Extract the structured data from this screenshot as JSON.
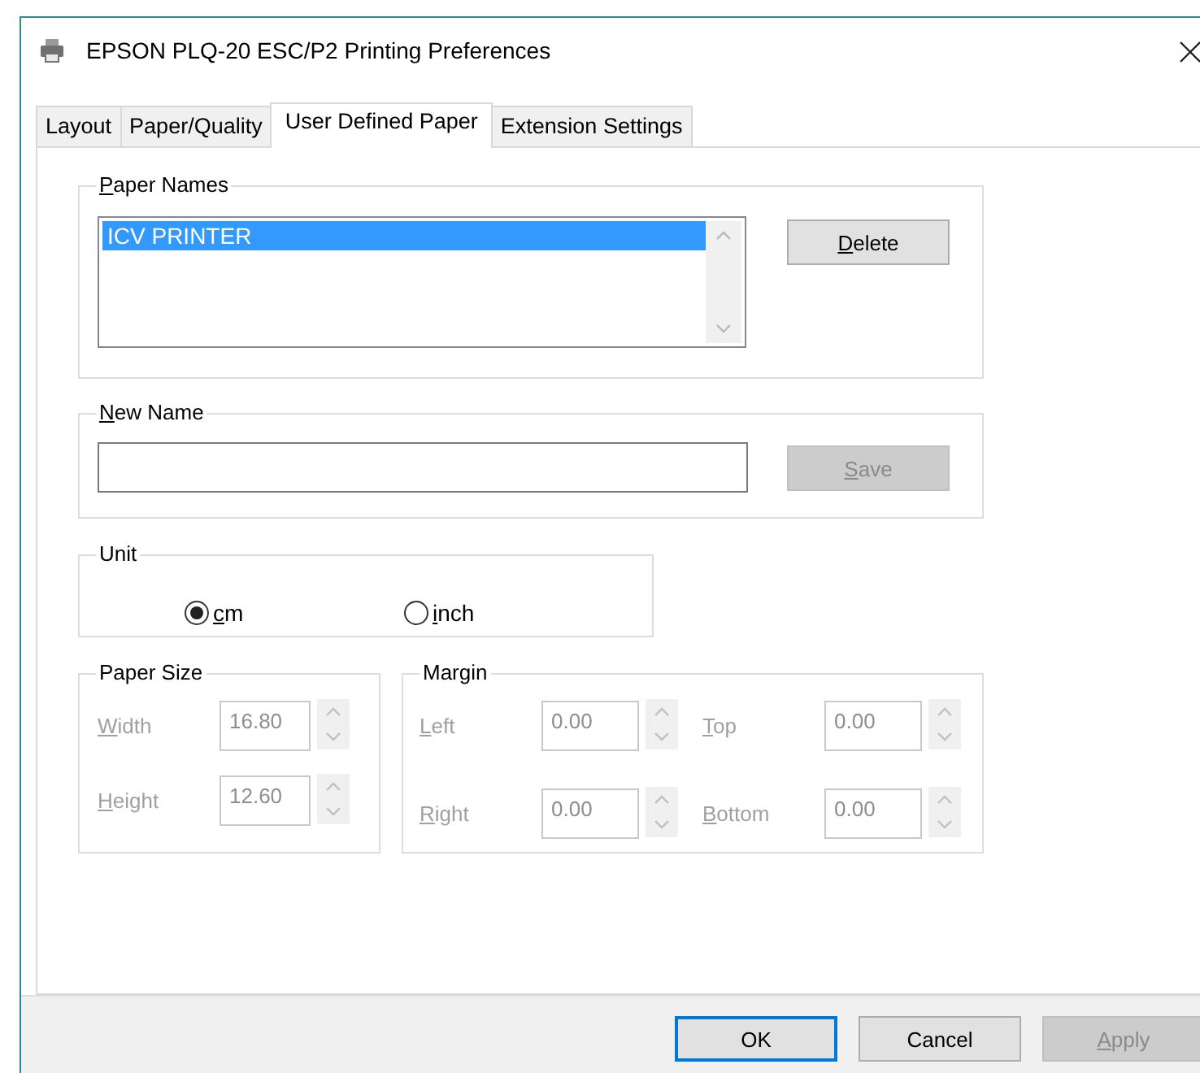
{
  "window": {
    "title": "EPSON PLQ-20 ESC/P2 Printing Preferences"
  },
  "tabs": [
    {
      "label": "Layout",
      "selected": false
    },
    {
      "label": "Paper/Quality",
      "selected": false
    },
    {
      "label": "User Defined Paper",
      "selected": true
    },
    {
      "label": "Extension Settings",
      "selected": false
    }
  ],
  "paper_names": {
    "label": "Paper Names",
    "mnemonic": true,
    "items": [
      {
        "text": "ICV PRINTER",
        "selected": true
      }
    ],
    "button": {
      "label": "Delete",
      "mnemonic": true,
      "disabled": false
    }
  },
  "new_name": {
    "label": "New Name",
    "mnemonic": true,
    "button": {
      "label": "Save",
      "mnemonic": true,
      "disabled": true
    }
  },
  "unit": {
    "label": "Unit",
    "options": [
      {
        "label": "cm",
        "mnemonic": true,
        "selected": true
      },
      {
        "label": "inch",
        "mnemonic": true,
        "selected": false
      }
    ]
  },
  "paper_size": {
    "label": "Paper Size",
    "disabled": true,
    "fields": [
      {
        "label": "Width",
        "mnemonic": true,
        "value": "16.80"
      },
      {
        "label": "Height",
        "mnemonic": true,
        "value": "12.60"
      }
    ]
  },
  "margin": {
    "label": "Margin",
    "disabled": true,
    "fields": [
      {
        "label": "Left",
        "mnemonic": true,
        "value": "0.00"
      },
      {
        "label": "Top",
        "mnemonic": true,
        "value": "0.00"
      },
      {
        "label": "Right",
        "mnemonic": true,
        "value": "0.00"
      },
      {
        "label": "Bottom",
        "mnemonic": true,
        "value": "0.00"
      }
    ]
  },
  "buttons": [
    {
      "label": "OK",
      "mnemonic": false,
      "default": true,
      "disabled": false
    },
    {
      "label": "Cancel",
      "mnemonic": false,
      "default": false,
      "disabled": false
    },
    {
      "label": "Apply",
      "mnemonic": true,
      "default": false,
      "disabled": true
    }
  ]
}
